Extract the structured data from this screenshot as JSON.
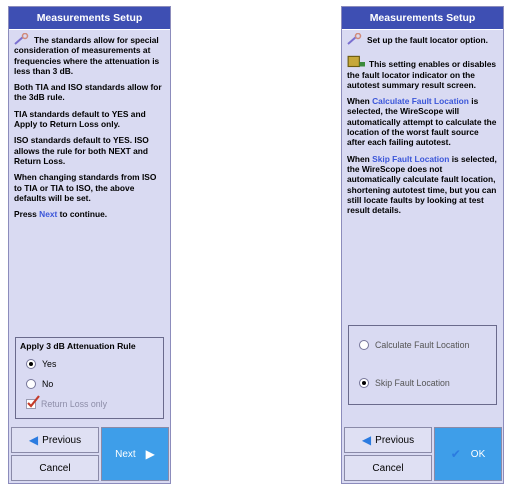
{
  "left": {
    "title": "Measurements Setup",
    "intro": "The standards allow for special consideration of measurements at frequencies where the attenuation is less than 3 dB.",
    "p2": "Both TIA and ISO standards allow for the 3dB rule.",
    "p3": "TIA standards default to YES and Apply to Return Loss only.",
    "p4": "ISO standards default to YES. ISO allows the rule for both NEXT and Return Loss.",
    "p5": "When changing standards from ISO to TIA or TIA to ISO, the above defaults will be set.",
    "p6_pre": "Press ",
    "p6_link": "Next",
    "p6_post": " to continue.",
    "group_title": "Apply 3 dB Attenuation Rule",
    "opt_yes": "Yes",
    "opt_no": "No",
    "opt_return": "Return Loss only",
    "btn_previous": "Previous",
    "btn_next": "Next",
    "btn_cancel": "Cancel"
  },
  "right": {
    "title": "Measurements Setup",
    "intro": "Set up the fault locator option.",
    "p2": "This setting enables or disables the fault locator indicator on the autotest summary result screen.",
    "p3_pre": "When ",
    "p3_link": "Calculate Fault Location",
    "p3_post": " is selected, the WireScope will automatically attempt to calculate the location of the worst fault source after each failing autotest.",
    "p4_pre": "When ",
    "p4_link": "Skip Fault Location",
    "p4_post": " is selected, the WireScope does not automatically calculate fault location, shortening autotest time, but you can still locate faults by looking at test result details.",
    "opt_calc": "Calculate Fault Location",
    "opt_skip": "Skip Fault Location",
    "btn_previous": "Previous",
    "btn_ok": "OK",
    "btn_cancel": "Cancel"
  }
}
